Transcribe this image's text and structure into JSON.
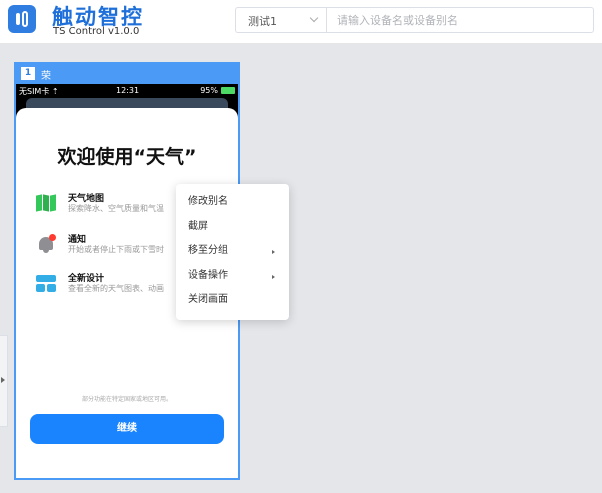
{
  "header": {
    "title": "触动智控",
    "version": "TS Control v1.0.0",
    "group_select": {
      "value": "测试1"
    },
    "search": {
      "placeholder": "请输入设备名或设备别名"
    }
  },
  "device": {
    "index": "1",
    "name": "荣",
    "status_bar": {
      "carrier": "无SIM卡 ⇡",
      "time": "12:31",
      "battery": "95%"
    },
    "screen": {
      "title": "欢迎使用“天气”",
      "features": [
        {
          "icon": "map-icon",
          "title": "天气地图",
          "desc": "探索降水、空气质量和气温"
        },
        {
          "icon": "bell-icon",
          "title": "通知",
          "desc": "开始或者停止下雨或下雪时"
        },
        {
          "icon": "layout-icon",
          "title": "全新设计",
          "desc": "查看全新的天气图表、动画"
        }
      ],
      "footnote": "部分功能在特定国家或地区可用。",
      "continue_label": "继续"
    }
  },
  "context_menu": {
    "items": [
      {
        "label": "修改别名",
        "has_submenu": false
      },
      {
        "label": "截屏",
        "has_submenu": false
      },
      {
        "label": "移至分组",
        "has_submenu": true
      },
      {
        "label": "设备操作",
        "has_submenu": true
      },
      {
        "label": "关闭画面",
        "has_submenu": false
      }
    ]
  },
  "colors": {
    "brand": "#1e6fd9",
    "accent": "#4b9af5",
    "button": "#1a84ff"
  }
}
